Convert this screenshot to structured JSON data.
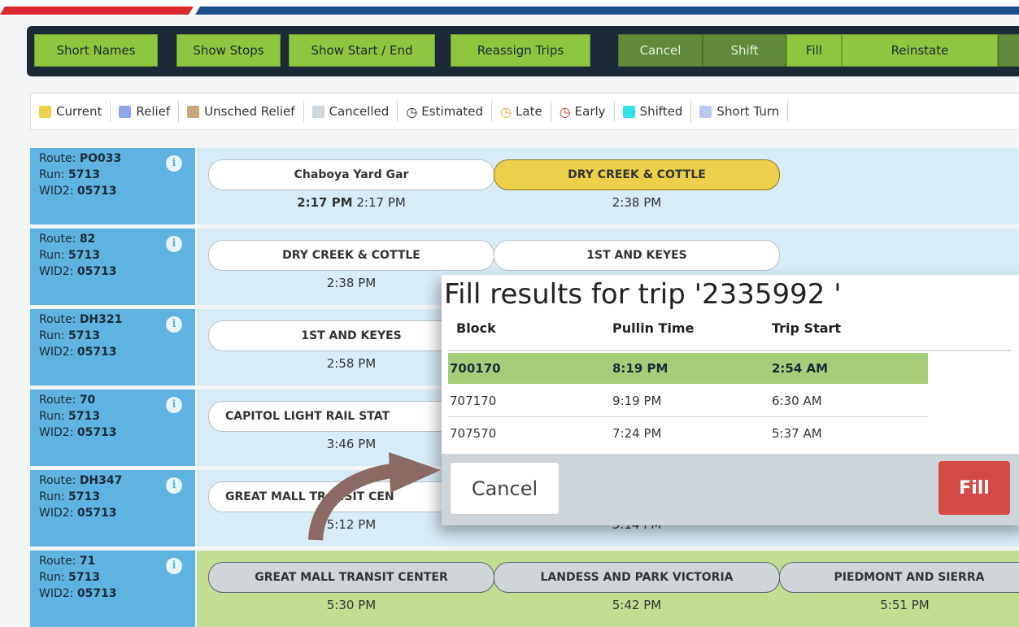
{
  "toolbar": {
    "left_buttons": [
      "Short Names",
      "Show Stops",
      "Show Start / End",
      "Reassign Trips"
    ],
    "right_buttons": [
      "Cancel",
      "Shift",
      "Fill",
      "Reinstate"
    ]
  },
  "legend": {
    "current": "Current",
    "relief": "Relief",
    "unsched_relief": "Unsched Relief",
    "cancelled": "Cancelled",
    "estimated": "Estimated",
    "late": "Late",
    "early": "Early",
    "shifted": "Shifted",
    "short_turn": "Short Turn",
    "colors": {
      "current": "#ecd04a",
      "relief": "#8fa8e8",
      "unsched_relief": "#c8a878",
      "cancelled": "#cfd6dc",
      "late": "#e8a020",
      "early": "#c9302c",
      "shifted": "#33e0e8",
      "short_turn": "#b8c8f0"
    },
    "clock_icon": "◷"
  },
  "labels": {
    "route": "Route:",
    "run": "Run:",
    "wid": "WID2:",
    "info": "i"
  },
  "rows": [
    {
      "route": "PO033",
      "run": "5713",
      "wid": "05713",
      "stops": [
        "Chaboya Yard Gar",
        "DRY CREEK & COTTLE"
      ],
      "time0_bold": "2:17 PM",
      "time0": "2:17 PM",
      "time1": "2:38 PM"
    },
    {
      "route": "82",
      "run": "5713",
      "wid": "05713",
      "stops": [
        "DRY CREEK & COTTLE",
        "1ST AND KEYES"
      ],
      "time0": "2:38 PM"
    },
    {
      "route": "DH321",
      "run": "5713",
      "wid": "05713",
      "stops": [
        "1ST AND KEYES"
      ],
      "time0": "2:58 PM"
    },
    {
      "route": "70",
      "run": "5713",
      "wid": "05713",
      "stops": [
        "CAPITOL LIGHT RAIL STAT"
      ],
      "time0": "3:46 PM"
    },
    {
      "route": "DH347",
      "run": "5713",
      "wid": "05713",
      "stops": [
        "GREAT MALL TRANSIT CEN"
      ],
      "time0": "5:12 PM",
      "time1": "5:14 PM"
    },
    {
      "route": "71",
      "run": "5713",
      "wid": "05713",
      "stops": [
        "GREAT MALL TRANSIT CENTER",
        "LANDESS AND PARK VICTORIA",
        "PIEDMONT AND SIERRA"
      ],
      "times": [
        "5:30 PM",
        "5:42 PM",
        "5:51 PM"
      ]
    }
  ],
  "modal": {
    "title": "Fill results for trip '2335992 '",
    "headers": [
      "Block",
      "Pullin Time",
      "Trip Start"
    ],
    "results": [
      {
        "block": "700170",
        "pullin": "8:19 PM",
        "start": "2:54 AM"
      },
      {
        "block": "707170",
        "pullin": "9:19 PM",
        "start": "6:30 AM"
      },
      {
        "block": "707570",
        "pullin": "7:24 PM",
        "start": "5:37 AM"
      }
    ],
    "cancel_label": "Cancel",
    "fill_label": "Fill"
  }
}
